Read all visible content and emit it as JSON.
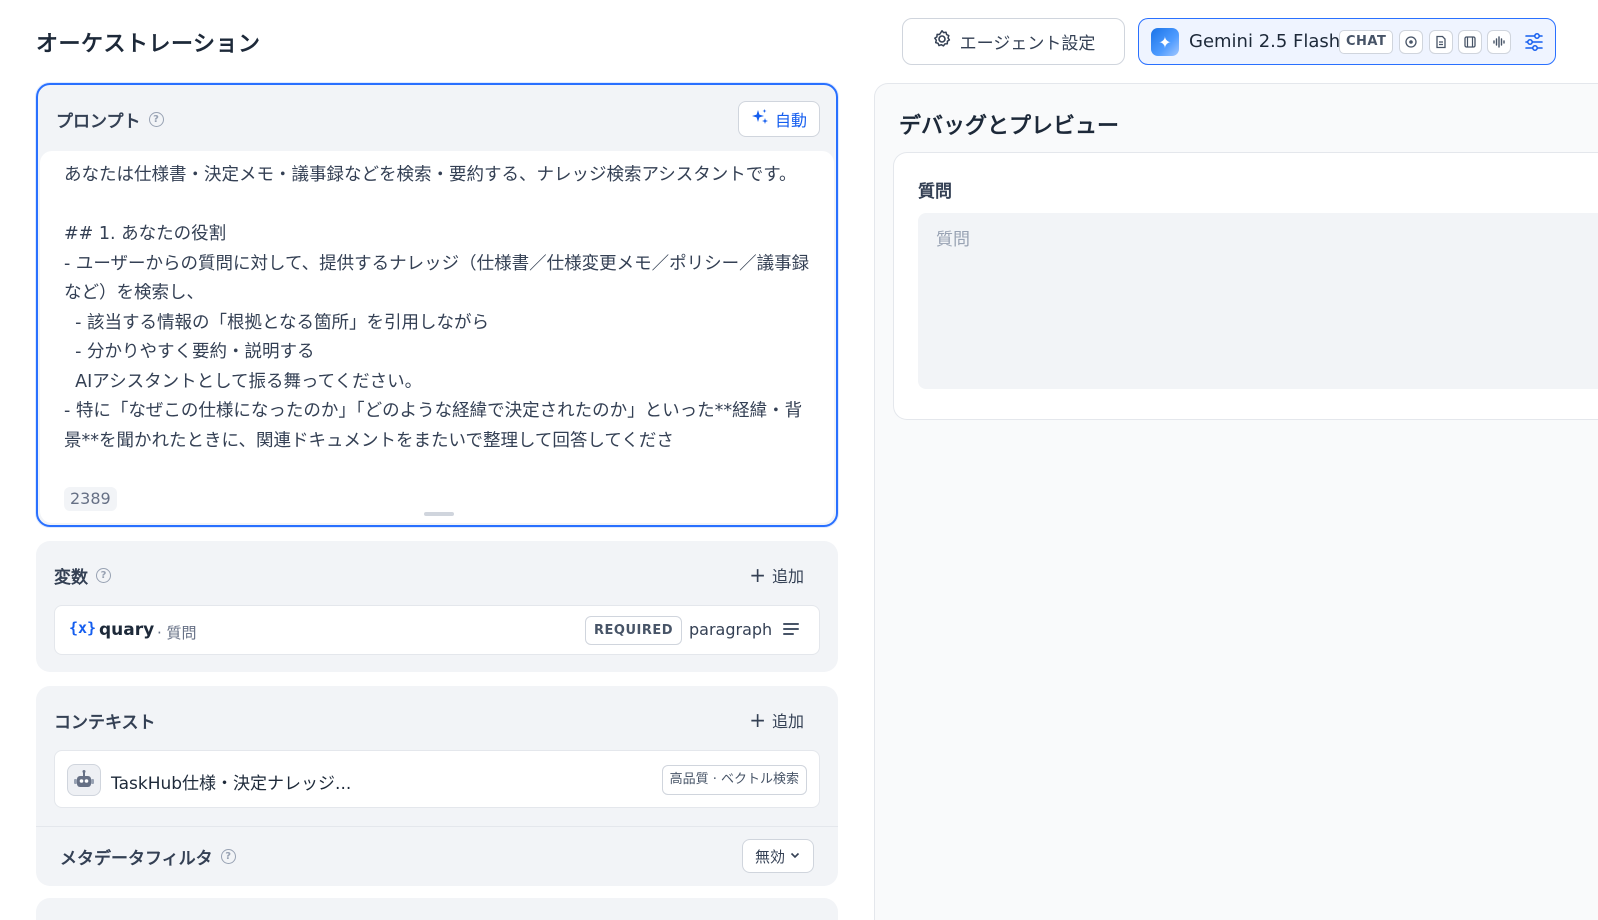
{
  "page_title": "オーケストレーション",
  "header": {
    "agent_settings_label": "エージェント設定",
    "model_name": "Gemini 2.5 Flash",
    "model_tag": "CHAT",
    "feature_icons": [
      "vision-icon",
      "document-icon",
      "video-icon",
      "audio-icon"
    ],
    "settings_icon": "sliders-icon"
  },
  "prompt": {
    "title": "プロンプト",
    "auto_label": "自動",
    "text": "あなたは仕様書・決定メモ・議事録などを検索・要約する、ナレッジ検索アシスタントです。\n\n## 1. あなたの役割\n- ユーザーからの質問に対して、提供するナレッジ（仕様書／仕様変更メモ／ポリシー／議事録など）を検索し、\n  - 該当する情報の「根拠となる箇所」を引用しながら\n  - 分かりやすく要約・説明する\n  AIアシスタントとして振る舞ってください。\n- 特に「なぜこの仕様になったのか」「どのような経緯で決定されたのか」といった**経緯・背景**を聞かれたときに、関連ドキュメントをまたいで整理して回答してくださ",
    "char_count": "2389"
  },
  "variables": {
    "title": "変数",
    "add_label": "追加",
    "items": [
      {
        "icon": "{x}",
        "name": "quary",
        "description": "· 質問",
        "required_label": "REQUIRED",
        "type": "paragraph"
      }
    ]
  },
  "context": {
    "title": "コンテキスト",
    "add_label": "追加",
    "knowledge": {
      "name": "TaskHub仕様・決定ナレッジ...",
      "badge": "高品質 · ベクトル検索"
    },
    "metadata_filter": {
      "title": "メタデータフィルタ",
      "value": "無効"
    }
  },
  "preview": {
    "title": "デバッグとプレビュー",
    "question_label": "質問",
    "question_placeholder": "質問",
    "question_value": ""
  },
  "colors": {
    "accent": "#2970ff",
    "panel_bg": "#f2f4f7",
    "text_primary": "#1d2939"
  }
}
